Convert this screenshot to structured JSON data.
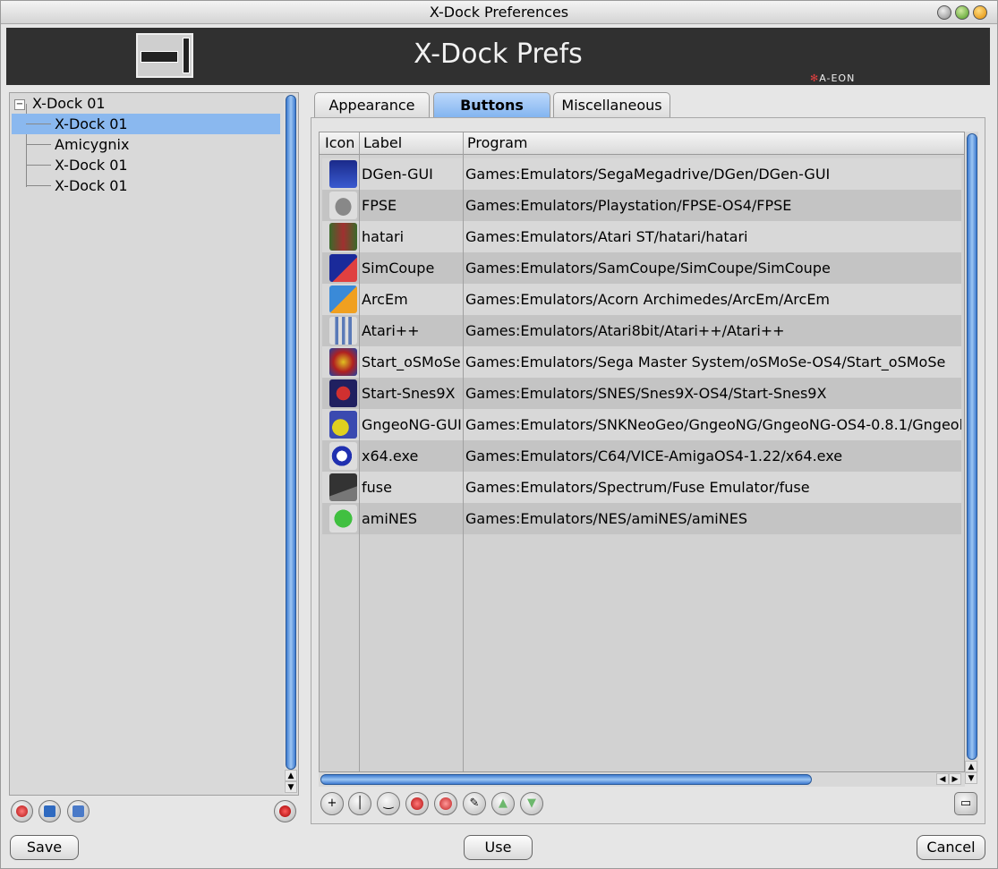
{
  "window": {
    "title": "X-Dock Preferences"
  },
  "banner": {
    "title": "X-Dock Prefs",
    "brand": "A-EON"
  },
  "tree": {
    "root": "X-Dock 01",
    "items": [
      {
        "label": "X-Dock 01",
        "selected": true
      },
      {
        "label": "Amicygnix",
        "selected": false
      },
      {
        "label": "X-Dock 01",
        "selected": false
      },
      {
        "label": "X-Dock 01",
        "selected": false
      }
    ]
  },
  "tabs": [
    {
      "label": "Appearance",
      "active": false
    },
    {
      "label": "Buttons",
      "active": true
    },
    {
      "label": "Miscellaneous",
      "active": false
    }
  ],
  "list": {
    "columns": [
      "Icon",
      "Label",
      "Program"
    ],
    "rows": [
      {
        "icon": "dgen-icon",
        "label": "DGen-GUI",
        "program": "Games:Emulators/SegaMegadrive/DGen/DGen-GUI"
      },
      {
        "icon": "gamepad-icon",
        "label": "FPSE",
        "program": "Games:Emulators/Playstation/FPSE-OS4/FPSE"
      },
      {
        "icon": "hatari-icon",
        "label": "hatari",
        "program": "Games:Emulators/Atari ST/hatari/hatari"
      },
      {
        "icon": "simcoupe-icon",
        "label": "SimCoupe",
        "program": "Games:Emulators/SamCoupe/SimCoupe/SimCoupe"
      },
      {
        "icon": "arcem-icon",
        "label": "ArcEm",
        "program": "Games:Emulators/Acorn Archimedes/ArcEm/ArcEm"
      },
      {
        "icon": "atari-logo-icon",
        "label": "Atari++",
        "program": "Games:Emulators/Atari8bit/Atari++/Atari++"
      },
      {
        "icon": "osmose-icon",
        "label": "Start_oSMoSe",
        "program": "Games:Emulators/Sega Master System/oSMoSe-OS4/Start_oSMoSe"
      },
      {
        "icon": "snes9x-icon",
        "label": "Start-Snes9X",
        "program": "Games:Emulators/SNES/Snes9X-OS4/Start-Snes9X"
      },
      {
        "icon": "gngeo-icon",
        "label": "GngeoNG-GUI",
        "program": "Games:Emulators/SNKNeoGeo/GngeoNG/GngeoNG-OS4-0.8.1/Gngeol"
      },
      {
        "icon": "commodore-icon",
        "label": "x64.exe",
        "program": "Games:Emulators/C64/VICE-AmigaOS4-1.22/x64.exe"
      },
      {
        "icon": "spectrum-icon",
        "label": "fuse",
        "program": "Games:Emulators/Spectrum/Fuse Emulator/fuse"
      },
      {
        "icon": "aminess-icon",
        "label": "amiNES",
        "program": "Games:Emulators/NES/amiNES/amiNES"
      }
    ]
  },
  "buttons": {
    "save": "Save",
    "use": "Use",
    "cancel": "Cancel"
  },
  "colors": {
    "selection": "#8ab8ef",
    "active_tab": "#7fb2ef",
    "scroll_thumb": "#3d7ad0",
    "banner": "#303030"
  },
  "scroll": {
    "list_horizontal_visible_fraction": 0.8
  }
}
